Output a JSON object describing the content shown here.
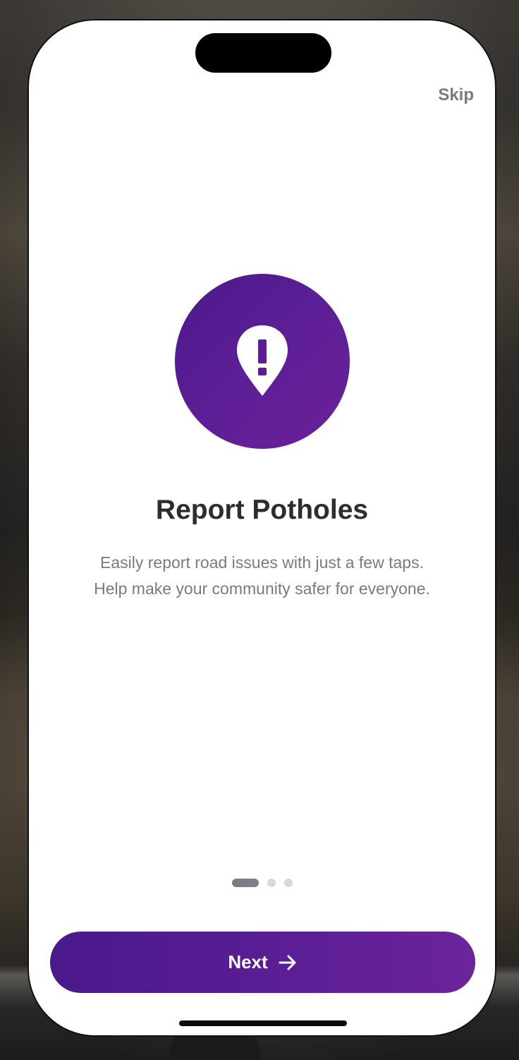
{
  "onboarding": {
    "skip_label": "Skip",
    "hero_icon": "map-pin-exclamation-icon",
    "title": "Report Potholes",
    "description": "Easily report road issues with just a few taps. Help make your community safer for everyone.",
    "page_indicator": {
      "total_pages": 3,
      "current_page": 1
    },
    "next_label": "Next",
    "next_icon": "arrow-right-icon"
  },
  "colors": {
    "accent_start": "#4a1a8c",
    "accent_end": "#6c2499",
    "title_text": "#2d2d2f",
    "secondary_text": "#7a7a80"
  }
}
